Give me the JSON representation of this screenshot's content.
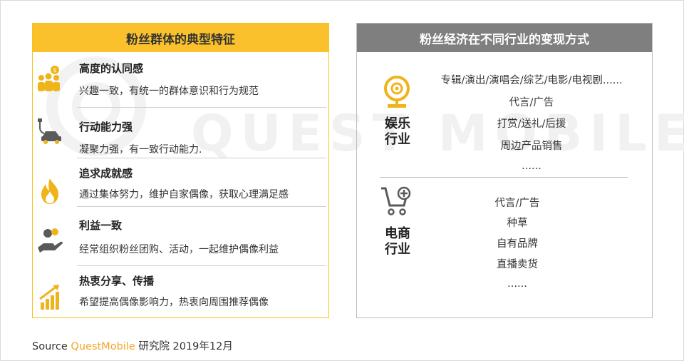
{
  "watermark": "QUEST MOBILE",
  "left": {
    "header": "粉丝群体的典型特征",
    "traits": [
      {
        "title": "高度的认同感",
        "desc": "兴趣一致，有统一的群体意识和行为规范",
        "icon": "people-coin-icon"
      },
      {
        "title": "行动能力强",
        "desc": "凝聚力强，有一致行动能力.",
        "icon": "car-plug-icon"
      },
      {
        "title": "追求成就感",
        "desc": "通过集体努力，维护自家偶像，获取心理满足感",
        "icon": "flame-icon"
      },
      {
        "title": "利益一致",
        "desc": "经常组织粉丝团购、活动，一起维护偶像利益",
        "icon": "hand-coins-icon"
      },
      {
        "title": "热衷分享、传播",
        "desc": "希望提高偶像影响力，热衷向周围推荐偶像",
        "icon": "growth-chart-icon"
      }
    ]
  },
  "right": {
    "header": "粉丝经济在不同行业的变现方式",
    "entertainment": {
      "label_line1": "娱乐",
      "label_line2": "行业",
      "icon": "webcam-icon",
      "items": [
        "专辑/演出/演唱会/综艺/电影/电视剧......",
        "代言/广告",
        "打赏/送礼/后援",
        "周边产品销售",
        "......"
      ]
    },
    "ecommerce": {
      "label_line1": "电商",
      "label_line2": "行业",
      "icon": "cart-add-icon",
      "items": [
        "代言/广告",
        "种草",
        "自有品牌",
        "直播卖货",
        "......"
      ]
    }
  },
  "source": {
    "prefix": "Source",
    "brand": "QuestMobile",
    "suffix": "研究院 2019年12月"
  },
  "colors": {
    "accent_yellow": "#fbc12d",
    "icon_gold": "#f0b41b",
    "header_gray": "#7f7f7f",
    "icon_dark": "#5a5a5a"
  }
}
